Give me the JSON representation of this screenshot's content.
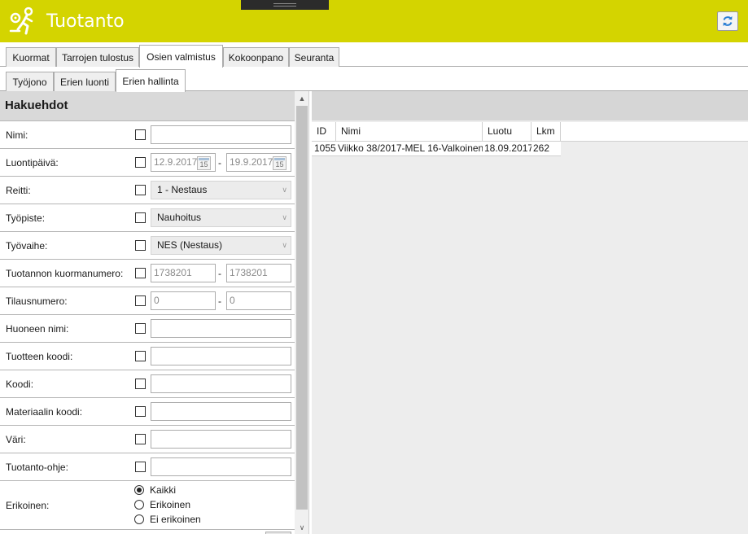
{
  "app": {
    "title": "Tuotanto",
    "accent_color": "#d4d400",
    "logo_icon": "worker-icon",
    "refresh_icon": "refresh-icon"
  },
  "main_tabs": [
    {
      "label": "Kuormat",
      "active": false
    },
    {
      "label": "Tarrojen tulostus",
      "active": false
    },
    {
      "label": "Osien valmistus",
      "active": true
    },
    {
      "label": "Kokoonpano",
      "active": false
    },
    {
      "label": "Seuranta",
      "active": false
    }
  ],
  "sub_tabs": [
    {
      "label": "Työjono",
      "active": false
    },
    {
      "label": "Erien luonti",
      "active": false
    },
    {
      "label": "Erien hallinta",
      "active": true
    }
  ],
  "search": {
    "title": "Hakuehdot",
    "fields": {
      "nimi": {
        "label": "Nimi:",
        "value": ""
      },
      "luontipaiva": {
        "label": "Luontipäivä:",
        "from": "12.9.2017",
        "to": "19.9.2017",
        "calendar_day": "15"
      },
      "reitti": {
        "label": "Reitti:",
        "value": "1 - Nestaus"
      },
      "tyopiste": {
        "label": "Työpiste:",
        "value": "Nauhoitus"
      },
      "tyovaihe": {
        "label": "Työvaihe:",
        "value": "NES (Nestaus)"
      },
      "kuormanumero": {
        "label": "Tuotannon kuormanumero:",
        "from": "1738201",
        "to": "1738201"
      },
      "tilausnumero": {
        "label": "Tilausnumero:",
        "from": "0",
        "to": "0"
      },
      "huoneen_nimi": {
        "label": "Huoneen nimi:",
        "value": ""
      },
      "tuotteen_koodi": {
        "label": "Tuotteen koodi:",
        "value": ""
      },
      "koodi": {
        "label": "Koodi:",
        "value": ""
      },
      "materiaalin_koodi": {
        "label": "Materiaalin koodi:",
        "value": ""
      },
      "vari": {
        "label": "Väri:",
        "value": ""
      },
      "tuotanto_ohje": {
        "label": "Tuotanto-ohje:",
        "value": ""
      },
      "erikoinen": {
        "label": "Erikoinen:",
        "options": [
          "Kaikki",
          "Erikoinen",
          "Ei erikoinen"
        ],
        "selected": "Kaikki"
      }
    },
    "range_separator": "-"
  },
  "results": {
    "columns": [
      "ID",
      "Nimi",
      "Luotu",
      "Lkm"
    ],
    "rows": [
      {
        "id": "1055",
        "nimi": "Viikko 38/2017-MEL 16-Valkoinen",
        "luotu": "18.09.2017",
        "lkm": "262"
      }
    ]
  }
}
